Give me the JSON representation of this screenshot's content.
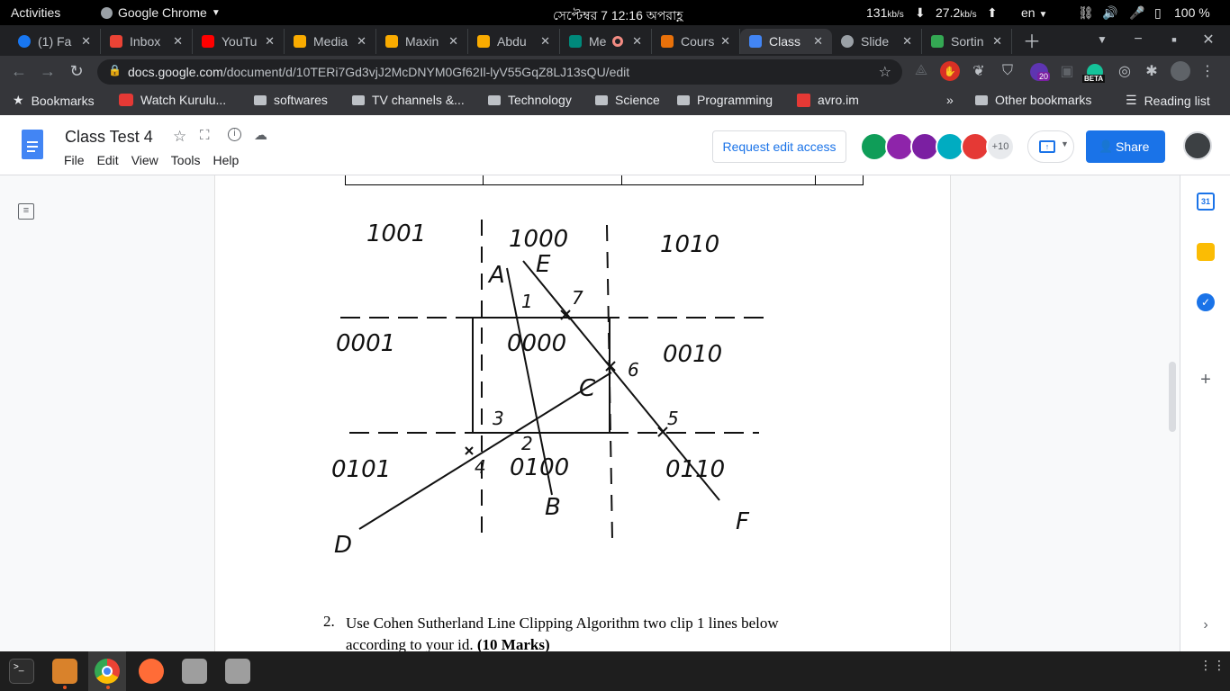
{
  "system_bar": {
    "activities": "Activities",
    "app_name": "Google Chrome",
    "clock": "সেপ্টেম্বর 7  12:16 অপরাহ্ণ",
    "net_down": "131",
    "net_down_unit": "kb/s",
    "net_up": "27.2",
    "net_up_unit": "kb/s",
    "lang": "en",
    "battery": "100 %"
  },
  "tabs": [
    {
      "label": "(1) Fa",
      "color": "#1877f2"
    },
    {
      "label": "Inbox",
      "color": "#ea4335"
    },
    {
      "label": "YouTu",
      "color": "#ff0000"
    },
    {
      "label": "Media",
      "color": "#f9ab00"
    },
    {
      "label": "Maxin",
      "color": "#f9ab00"
    },
    {
      "label": "Abdu",
      "color": "#f9ab00"
    },
    {
      "label": "Me",
      "color": "#00897b"
    },
    {
      "label": "Cours",
      "color": "#e8710a"
    },
    {
      "label": "Class",
      "color": "#4285f4"
    },
    {
      "label": "Slide",
      "color": "#9aa0a6"
    },
    {
      "label": "Sortin",
      "color": "#34a853"
    }
  ],
  "omnibox": {
    "domain": "docs.google.com",
    "path": "/document/d/10TERi7Gd3vjJ2McDNYM0Gf62Il-lyV55GqZ8LJ13sQU/edit"
  },
  "bookmarks": {
    "star_label": "Bookmarks",
    "items": [
      "Watch Kurulu...",
      "softwares",
      "TV channels &...",
      "Technology",
      "Science",
      "Programming",
      "avro.im"
    ],
    "other": "Other bookmarks",
    "reading": "Reading list",
    "more": "»"
  },
  "docs": {
    "title": "Class Test 4",
    "menu": [
      "File",
      "Edit",
      "View",
      "Tools",
      "Help"
    ],
    "request_edit": "Request edit access",
    "share": "Share",
    "more_collaborators": "+10",
    "accent": "#1a73e8"
  },
  "document": {
    "question_number": "2.",
    "question_text": "Use Cohen Sutherland Line Clipping Algorithm two clip 1 lines below",
    "question_text_2": "according to your id. ",
    "marks": "(10 Marks)"
  },
  "sketch": {
    "region_codes": [
      "1001",
      "1000",
      "1010",
      "0001",
      "0000",
      "0010",
      "0101",
      "0100",
      "0110"
    ],
    "points": [
      "A",
      "B",
      "C",
      "D",
      "E",
      "F"
    ],
    "intersections": [
      "1",
      "2",
      "3",
      "4",
      "5",
      "6",
      "7"
    ]
  },
  "side_badges": {
    "calendar": "31",
    "extension_badge": "20",
    "beta": "BETA"
  }
}
